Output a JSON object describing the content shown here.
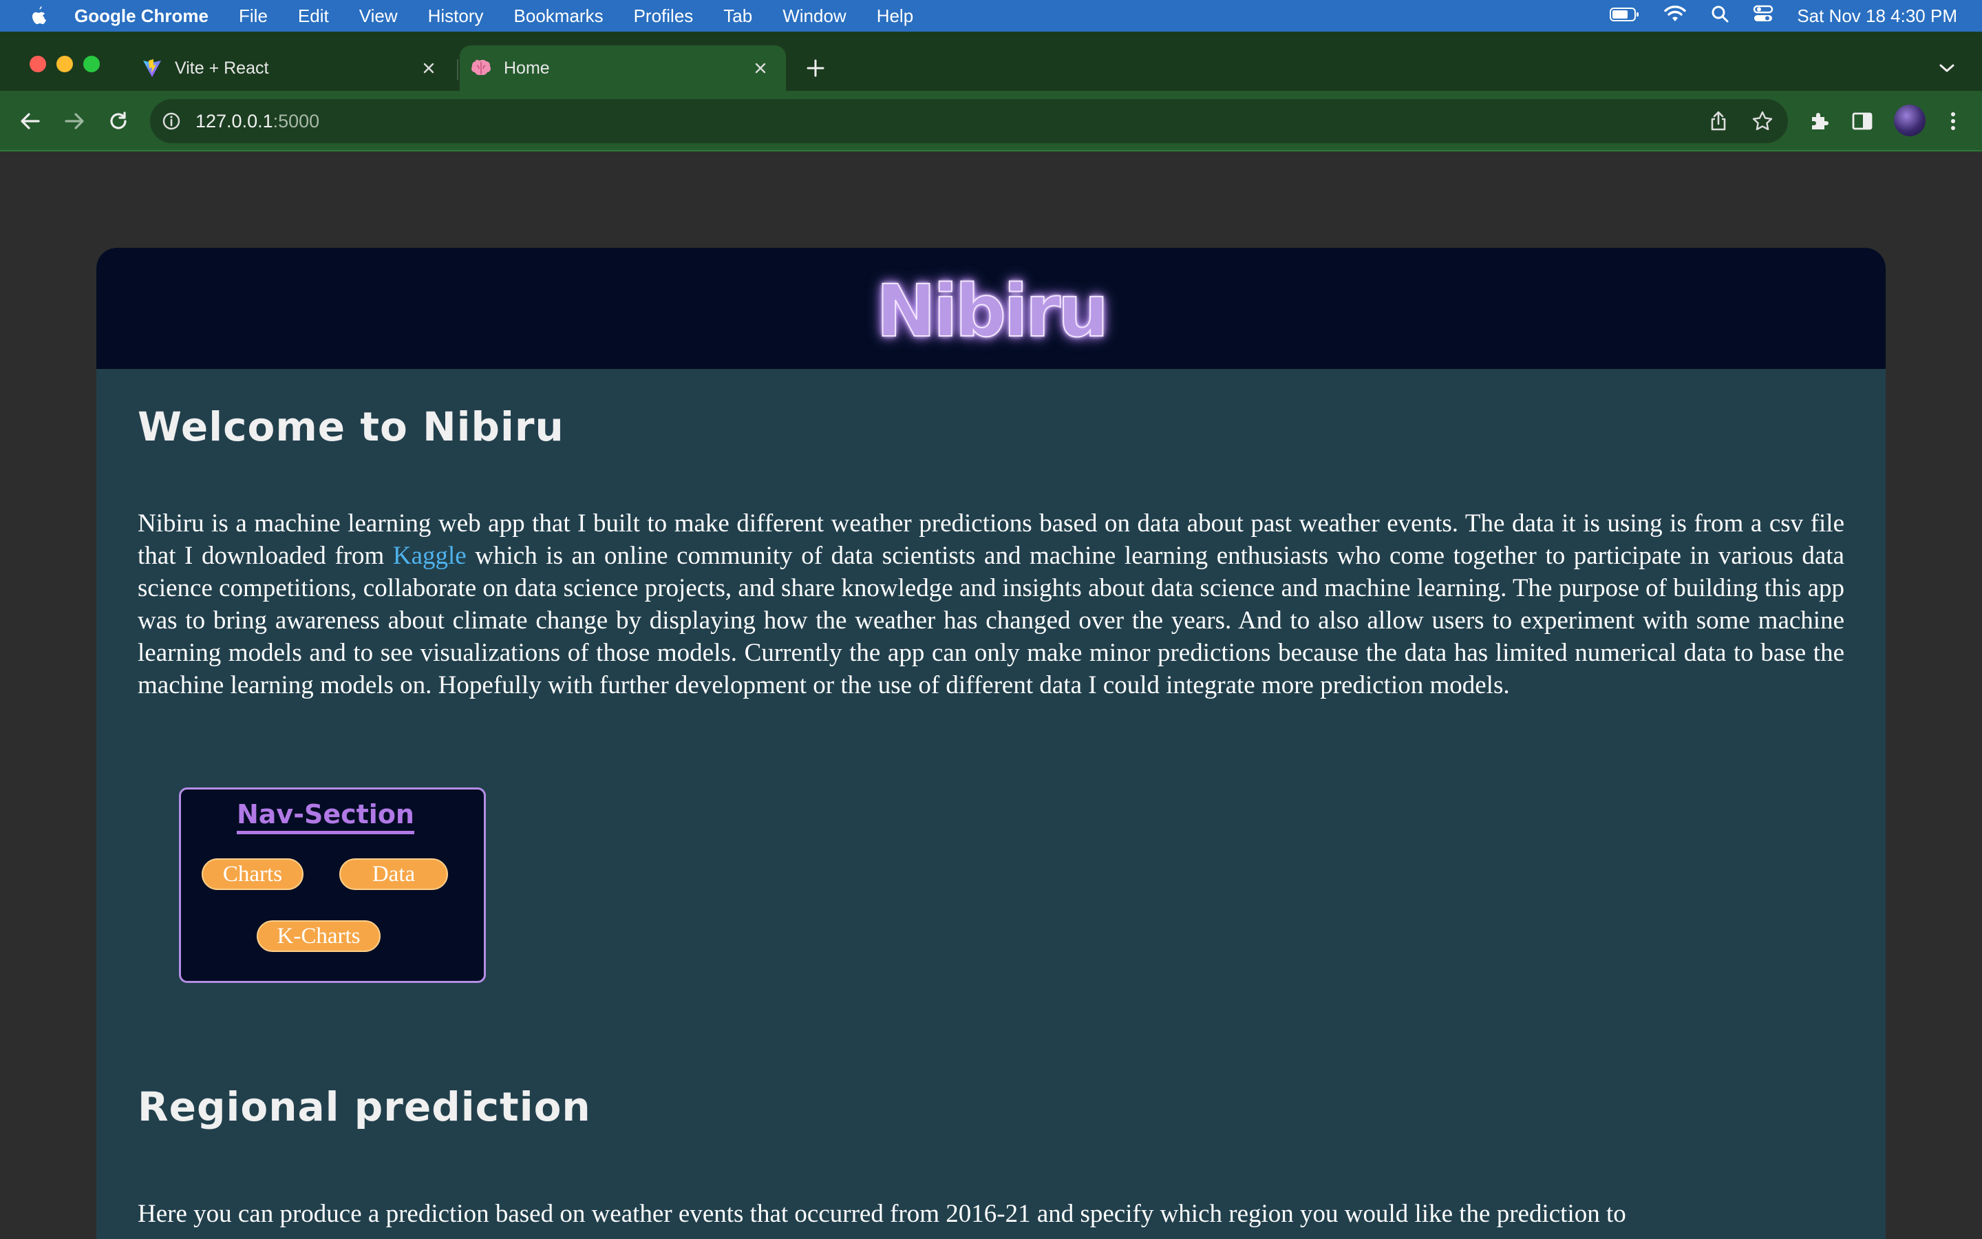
{
  "menubar": {
    "app_name": "Google Chrome",
    "items": [
      "File",
      "Edit",
      "View",
      "History",
      "Bookmarks",
      "Profiles",
      "Tab",
      "Window",
      "Help"
    ],
    "clock": "Sat Nov 18  4:30 PM"
  },
  "browser": {
    "tabs": [
      {
        "title": "Vite + React",
        "favicon": "vite-icon",
        "active": false
      },
      {
        "title": "Home",
        "favicon": "brain-icon",
        "active": true
      }
    ],
    "address": {
      "host": "127.0.0.1",
      "port": ":5000"
    }
  },
  "page": {
    "logo": "Nibiru",
    "welcome_heading": "Welcome to Nibiru",
    "intro": {
      "before_link": "Nibiru is a machine learning web app that I built to make different weather predictions based on data about past weather events. The data it is using is from a csv file that I downloaded from ",
      "link_text": "Kaggle",
      "after_link": " which is an online community of data scientists and machine learning enthusiasts who come together to participate in various data science competitions, collaborate on data science projects, and share knowledge and insights about data science and machine learning. The purpose of building this app was to bring awareness about climate change by displaying how the weather has changed over the years. And to also allow users to experiment with some machine learning models and to see visualizations of those models. Currently the app can only make minor predictions because the data has limited numerical data to base the machine learning models on. Hopefully with further development or the use of different data I could integrate more prediction models."
    },
    "nav": {
      "title": "Nav-Section",
      "buttons": [
        "Charts",
        "Data",
        "K-Charts"
      ]
    },
    "regional_heading": "Regional prediction",
    "regional_text": "Here you can produce a prediction based on weather events that occurred from 2016-21 and specify which region you would like the prediction to"
  },
  "colors": {
    "menubar": "#2a6fc1",
    "tabstrip": "#1a3a1e",
    "toolbar": "#255a2c",
    "card": "#22404c",
    "header": "#030c24",
    "logo": "#b89ae6",
    "link": "#4fb3ee",
    "pill": "#f6a647"
  }
}
